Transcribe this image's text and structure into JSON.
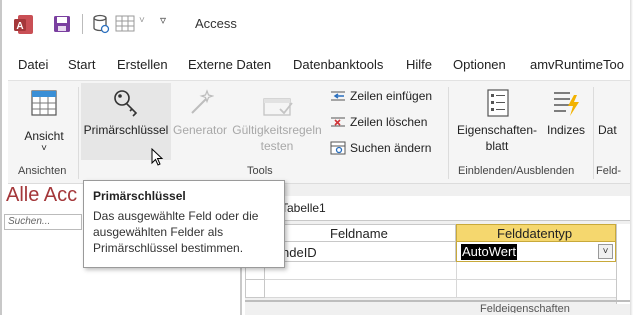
{
  "titlebar": {
    "title": "Access"
  },
  "menu": {
    "tabs": [
      "Datei",
      "Start",
      "Erstellen",
      "Externe Daten",
      "Datenbanktools",
      "Hilfe",
      "Optionen",
      "amvRuntimeToo"
    ]
  },
  "ribbon": {
    "ansicht": {
      "label": "Ansicht",
      "dropdown": "˅"
    },
    "primaerschluessel": "Primärschlüssel",
    "generator": "Generator",
    "gueltigkeit_1": "Gültigkeitsregeln",
    "gueltigkeit_2": "testen",
    "zeilen_einfuegen": "Zeilen einfügen",
    "zeilen_loeschen": "Zeilen löschen",
    "suchen_aendern": "Suchen ändern",
    "eigenschaften_1": "Eigenschaften-",
    "eigenschaften_2": "blatt",
    "indizes": "Indizes",
    "dat_1": "Dat",
    "dat_2": "Feld-",
    "groups": {
      "ansichten": "Ansichten",
      "tools": "Tools",
      "einblenden": "Einblenden/Ausblenden"
    }
  },
  "nav": {
    "title": "Alle Acc",
    "search_placeholder": "Suchen..."
  },
  "table": {
    "tab_label": "Tabelle1",
    "col_feldname": "Feldname",
    "col_felddatentyp": "Felddatentyp",
    "row1_feldname": "ndeID",
    "row1_datatype": "AutoWert",
    "footer": "Feldeigenschaften"
  },
  "tooltip": {
    "title": "Primärschlüssel",
    "body_1": "Das ausgewählte Feld oder die",
    "body_2": "ausgewählten Felder als",
    "body_3": "Primärschlüssel bestimmen."
  },
  "colors": {
    "access_red": "#a4373a",
    "header_yellow": "#f5d76e",
    "selected_cell": "#000000"
  }
}
